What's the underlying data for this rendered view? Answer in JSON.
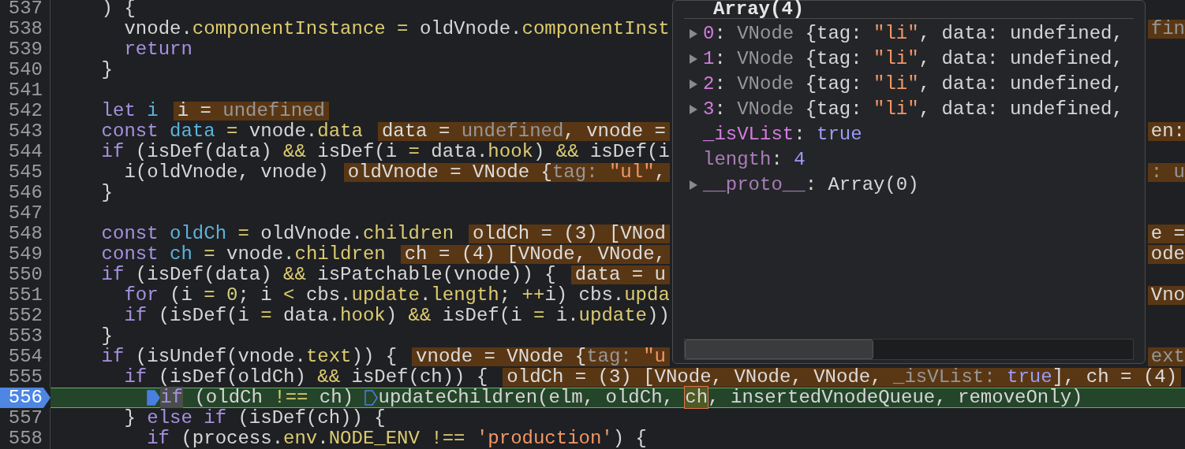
{
  "editor": {
    "lines": [
      {
        "number": "537",
        "paused": false,
        "parts": [
          {
            "kind": "code",
            "tokens": [
              {
                "text": "    ) {",
                "kind": "plain"
              }
            ]
          }
        ]
      },
      {
        "number": "538",
        "paused": false,
        "parts": [
          {
            "kind": "code",
            "tokens": [
              {
                "text": "      vnode.",
                "kind": "plain"
              },
              {
                "text": "componentInstance = ",
                "kind": "prop"
              },
              {
                "text": "oldVnode.",
                "kind": "plain"
              },
              {
                "text": "componentInst",
                "kind": "prop"
              }
            ]
          }
        ],
        "tail": [
          {
            "text": "fin",
            "kind": "dim"
          }
        ]
      },
      {
        "number": "539",
        "paused": false,
        "parts": [
          {
            "kind": "code",
            "tokens": [
              {
                "text": "      return",
                "kind": "keyword"
              }
            ]
          }
        ]
      },
      {
        "number": "540",
        "paused": false,
        "parts": [
          {
            "kind": "code",
            "tokens": [
              {
                "text": "    }",
                "kind": "plain"
              }
            ]
          }
        ]
      },
      {
        "number": "541",
        "paused": false
      },
      {
        "number": "542",
        "paused": false,
        "parts": [
          {
            "kind": "code",
            "tokens": [
              {
                "text": "    let ",
                "kind": "keyword"
              },
              {
                "text": "i",
                "kind": "decl"
              }
            ]
          },
          {
            "kind": "inline",
            "tokens": [
              {
                "text": "i = ",
                "kind": "plain"
              },
              {
                "text": "undefined",
                "kind": "dim"
              }
            ]
          }
        ]
      },
      {
        "number": "543",
        "paused": false,
        "parts": [
          {
            "kind": "code",
            "tokens": [
              {
                "text": "    const ",
                "kind": "keyword"
              },
              {
                "text": "data",
                "kind": "decl"
              },
              {
                "text": " = ",
                "kind": "prop"
              },
              {
                "text": "vnode.",
                "kind": "plain"
              },
              {
                "text": "data",
                "kind": "prop"
              }
            ]
          },
          {
            "kind": "inline",
            "tokens": [
              {
                "text": "data = ",
                "kind": "plain"
              },
              {
                "text": "undefined",
                "kind": "dim"
              },
              {
                "text": ", vnode =",
                "kind": "plain"
              }
            ]
          }
        ],
        "tail": [
          {
            "text": "en:",
            "kind": "plain"
          }
        ]
      },
      {
        "number": "544",
        "paused": false,
        "parts": [
          {
            "kind": "code",
            "tokens": [
              {
                "text": "    if ",
                "kind": "keyword"
              },
              {
                "text": "(isDef(data) ",
                "kind": "plain"
              },
              {
                "text": "&&",
                "kind": "prop"
              },
              {
                "text": " isDef(i ",
                "kind": "plain"
              },
              {
                "text": "=",
                "kind": "prop"
              },
              {
                "text": " data.",
                "kind": "plain"
              },
              {
                "text": "hook",
                "kind": "prop"
              },
              {
                "text": ") ",
                "kind": "plain"
              },
              {
                "text": "&&",
                "kind": "prop"
              },
              {
                "text": " isDef(i",
                "kind": "plain"
              }
            ]
          }
        ]
      },
      {
        "number": "545",
        "paused": false,
        "parts": [
          {
            "kind": "code",
            "tokens": [
              {
                "text": "      i(oldVnode, vnode)",
                "kind": "plain"
              }
            ]
          },
          {
            "kind": "inline",
            "tokens": [
              {
                "text": "oldVnode = VNode {",
                "kind": "plain"
              },
              {
                "text": "tag: ",
                "kind": "dim"
              },
              {
                "text": "\"ul\"",
                "kind": "string"
              },
              {
                "text": ",",
                "kind": "plain"
              }
            ]
          }
        ],
        "tail": [
          {
            "text": ": u",
            "kind": "dim"
          }
        ]
      },
      {
        "number": "546",
        "paused": false,
        "parts": [
          {
            "kind": "code",
            "tokens": [
              {
                "text": "    }",
                "kind": "plain"
              }
            ]
          }
        ]
      },
      {
        "number": "547",
        "paused": false
      },
      {
        "number": "548",
        "paused": false,
        "parts": [
          {
            "kind": "code",
            "tokens": [
              {
                "text": "    const ",
                "kind": "keyword"
              },
              {
                "text": "oldCh",
                "kind": "decl"
              },
              {
                "text": " = ",
                "kind": "prop"
              },
              {
                "text": "oldVnode.",
                "kind": "plain"
              },
              {
                "text": "children",
                "kind": "prop"
              }
            ]
          },
          {
            "kind": "inline",
            "tokens": [
              {
                "text": "oldCh = (3) [VNod",
                "kind": "plain"
              }
            ]
          }
        ],
        "tail": [
          {
            "text": "e =",
            "kind": "plain"
          }
        ]
      },
      {
        "number": "549",
        "paused": false,
        "parts": [
          {
            "kind": "code",
            "tokens": [
              {
                "text": "    const ",
                "kind": "keyword"
              },
              {
                "text": "ch",
                "kind": "decl"
              },
              {
                "text": " = ",
                "kind": "prop"
              },
              {
                "text": "vnode.",
                "kind": "plain"
              },
              {
                "text": "children",
                "kind": "prop"
              }
            ]
          },
          {
            "kind": "inline",
            "tokens": [
              {
                "text": "ch = (4) [VNode, VNode,",
                "kind": "plain"
              }
            ]
          }
        ],
        "tail": [
          {
            "text": "ode",
            "kind": "plain"
          }
        ]
      },
      {
        "number": "550",
        "paused": false,
        "parts": [
          {
            "kind": "code",
            "tokens": [
              {
                "text": "    if ",
                "kind": "keyword"
              },
              {
                "text": "(isDef(data) ",
                "kind": "plain"
              },
              {
                "text": "&&",
                "kind": "prop"
              },
              {
                "text": " isPatchable(vnode)) {",
                "kind": "plain"
              }
            ]
          },
          {
            "kind": "inline",
            "tokens": [
              {
                "text": "data = u",
                "kind": "plain"
              }
            ]
          }
        ]
      },
      {
        "number": "551",
        "paused": false,
        "parts": [
          {
            "kind": "code",
            "tokens": [
              {
                "text": "      for ",
                "kind": "keyword"
              },
              {
                "text": "(i ",
                "kind": "plain"
              },
              {
                "text": "= ",
                "kind": "prop"
              },
              {
                "text": "0",
                "kind": "number"
              },
              {
                "text": "; i ",
                "kind": "plain"
              },
              {
                "text": "<",
                "kind": "prop"
              },
              {
                "text": " cbs.",
                "kind": "plain"
              },
              {
                "text": "update",
                "kind": "prop"
              },
              {
                "text": ".",
                "kind": "plain"
              },
              {
                "text": "length",
                "kind": "prop"
              },
              {
                "text": "; ",
                "kind": "plain"
              },
              {
                "text": "++",
                "kind": "prop"
              },
              {
                "text": "i) cbs.",
                "kind": "plain"
              },
              {
                "text": "upda",
                "kind": "prop"
              }
            ]
          }
        ],
        "tail": [
          {
            "text": "Vno",
            "kind": "plain"
          }
        ]
      },
      {
        "number": "552",
        "paused": false,
        "parts": [
          {
            "kind": "code",
            "tokens": [
              {
                "text": "      if ",
                "kind": "keyword"
              },
              {
                "text": "(isDef(i ",
                "kind": "plain"
              },
              {
                "text": "=",
                "kind": "prop"
              },
              {
                "text": " data.",
                "kind": "plain"
              },
              {
                "text": "hook",
                "kind": "prop"
              },
              {
                "text": ") ",
                "kind": "plain"
              },
              {
                "text": "&&",
                "kind": "prop"
              },
              {
                "text": " isDef(i ",
                "kind": "plain"
              },
              {
                "text": "=",
                "kind": "prop"
              },
              {
                "text": " i.",
                "kind": "plain"
              },
              {
                "text": "update",
                "kind": "prop"
              },
              {
                "text": "))",
                "kind": "plain"
              }
            ]
          }
        ]
      },
      {
        "number": "553",
        "paused": false,
        "parts": [
          {
            "kind": "code",
            "tokens": [
              {
                "text": "    }",
                "kind": "plain"
              }
            ]
          }
        ]
      },
      {
        "number": "554",
        "paused": false,
        "parts": [
          {
            "kind": "code",
            "tokens": [
              {
                "text": "    if ",
                "kind": "keyword"
              },
              {
                "text": "(isUndef(vnode.",
                "kind": "plain"
              },
              {
                "text": "text",
                "kind": "prop"
              },
              {
                "text": ")) {",
                "kind": "plain"
              }
            ]
          },
          {
            "kind": "inline",
            "tokens": [
              {
                "text": "vnode = VNode {",
                "kind": "plain"
              },
              {
                "text": "tag: ",
                "kind": "dim"
              },
              {
                "text": "\"u",
                "kind": "string"
              }
            ]
          }
        ],
        "tail": [
          {
            "text": "ext",
            "kind": "dim"
          }
        ]
      },
      {
        "number": "555",
        "paused": false,
        "parts": [
          {
            "kind": "code",
            "tokens": [
              {
                "text": "      if ",
                "kind": "keyword"
              },
              {
                "text": "(isDef(oldCh) ",
                "kind": "plain"
              },
              {
                "text": "&&",
                "kind": "prop"
              },
              {
                "text": " isDef(ch)) {",
                "kind": "plain"
              }
            ]
          },
          {
            "kind": "inline",
            "tokens": [
              {
                "text": "oldCh = (3) [VNode, VNode, VNode, ",
                "kind": "plain"
              },
              {
                "text": "_isVList: ",
                "kind": "dim"
              },
              {
                "text": "true",
                "kind": "literal"
              },
              {
                "text": "], ch = (4)",
                "kind": "plain"
              }
            ]
          }
        ]
      },
      {
        "number": "556",
        "paused": true,
        "parts": [
          {
            "kind": "code",
            "breakpoint_active": true,
            "tokens": [
              {
                "text": "        if",
                "kind": "exec"
              },
              {
                "text": " (oldCh ",
                "kind": "plain"
              },
              {
                "text": "!==",
                "kind": "prop"
              },
              {
                "text": " ch) ",
                "kind": "plain"
              }
            ]
          },
          {
            "kind": "code",
            "breakpoint_active": false,
            "tokens": [
              {
                "text": "updateChildren(elm, oldCh, ",
                "kind": "plain"
              },
              {
                "text": "ch",
                "kind": "hover"
              },
              {
                "text": ", insertedVnodeQueue, removeOnly)",
                "kind": "plain"
              }
            ]
          }
        ]
      },
      {
        "number": "557",
        "paused": false,
        "parts": [
          {
            "kind": "code",
            "tokens": [
              {
                "text": "      } ",
                "kind": "plain"
              },
              {
                "text": "else if ",
                "kind": "keyword"
              },
              {
                "text": "(isDef(ch)) {",
                "kind": "plain"
              }
            ]
          }
        ]
      },
      {
        "number": "558",
        "paused": false,
        "parts": [
          {
            "kind": "code",
            "tokens": [
              {
                "text": "        if ",
                "kind": "keyword"
              },
              {
                "text": "(process.",
                "kind": "plain"
              },
              {
                "text": "env",
                "kind": "prop"
              },
              {
                "text": ".",
                "kind": "plain"
              },
              {
                "text": "NODE_ENV",
                "kind": "prop"
              },
              {
                "text": " !== ",
                "kind": "prop"
              },
              {
                "text": "'production'",
                "kind": "string"
              },
              {
                "text": ") {",
                "kind": "plain"
              }
            ]
          }
        ]
      }
    ]
  },
  "popover": {
    "title": "Array(4)",
    "entries": [
      {
        "key": "0",
        "enumerable": true,
        "expandable": true,
        "value": [
          {
            "text": ": ",
            "kind": "plain"
          },
          {
            "text": "VNode",
            "kind": "dim"
          },
          {
            "text": " {tag: ",
            "kind": "plain"
          },
          {
            "text": "\"li\"",
            "kind": "string"
          },
          {
            "text": ", data: undefined,",
            "kind": "plain"
          }
        ]
      },
      {
        "key": "1",
        "enumerable": true,
        "expandable": true,
        "value": [
          {
            "text": ": ",
            "kind": "plain"
          },
          {
            "text": "VNode",
            "kind": "dim"
          },
          {
            "text": " {tag: ",
            "kind": "plain"
          },
          {
            "text": "\"li\"",
            "kind": "string"
          },
          {
            "text": ", data: undefined,",
            "kind": "plain"
          }
        ]
      },
      {
        "key": "2",
        "enumerable": true,
        "expandable": true,
        "value": [
          {
            "text": ": ",
            "kind": "plain"
          },
          {
            "text": "VNode",
            "kind": "dim"
          },
          {
            "text": " {tag: ",
            "kind": "plain"
          },
          {
            "text": "\"li\"",
            "kind": "string"
          },
          {
            "text": ", data: undefined,",
            "kind": "plain"
          }
        ]
      },
      {
        "key": "3",
        "enumerable": true,
        "expandable": true,
        "value": [
          {
            "text": ": ",
            "kind": "plain"
          },
          {
            "text": "VNode",
            "kind": "dim"
          },
          {
            "text": " {tag: ",
            "kind": "plain"
          },
          {
            "text": "\"li\"",
            "kind": "string"
          },
          {
            "text": ", data: undefined,",
            "kind": "plain"
          }
        ]
      },
      {
        "key": "_isVList",
        "enumerable": true,
        "expandable": false,
        "value": [
          {
            "text": ": ",
            "kind": "plain"
          },
          {
            "text": "true",
            "kind": "literal"
          }
        ]
      },
      {
        "key": "length",
        "enumerable": false,
        "expandable": false,
        "value": [
          {
            "text": ": ",
            "kind": "plain"
          },
          {
            "text": "4",
            "kind": "literal"
          }
        ]
      },
      {
        "key": "__proto__",
        "enumerable": false,
        "expandable": true,
        "value": [
          {
            "text": ": ",
            "kind": "plain"
          },
          {
            "text": "Array(0)",
            "kind": "plain"
          }
        ]
      }
    ]
  }
}
